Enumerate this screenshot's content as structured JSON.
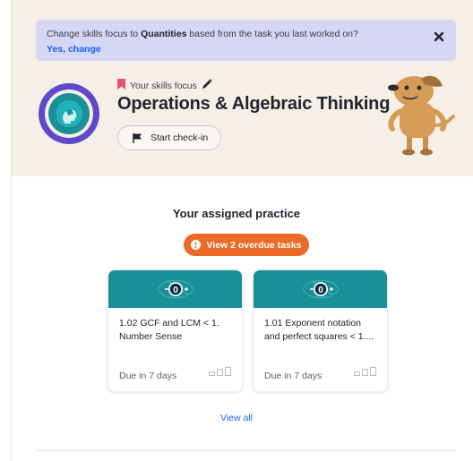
{
  "banner": {
    "text_before": "Change skills focus to ",
    "text_bold": "Quantities",
    "text_after": " based from the task you last worked on?",
    "link": "Yes, change"
  },
  "focus": {
    "label": "Your skills focus",
    "title": "Operations & Algebraic Thinking",
    "checkin_label": "Start check-in"
  },
  "practice": {
    "title": "Your assigned practice",
    "overdue_label": "View 2 overdue tasks",
    "cards": [
      {
        "title": "1.02 GCF and LCM < 1. Number Sense",
        "due": "Due in 7 days",
        "badge": "0"
      },
      {
        "title": "1.01 Exponent notation and perfect squares < 1....",
        "due": "Due in 7 days",
        "badge": "0"
      }
    ],
    "view_all": "View all"
  },
  "colors": {
    "hero_bg": "#f6efe8",
    "banner_bg": "#d6d6f5",
    "ring_purple": "#5d49c9",
    "ring_teal": "#1a8f97",
    "overdue": "#ea6a28",
    "card_header": "#1a8f97",
    "link": "#1865f2"
  },
  "icons": [
    "close-icon",
    "bookmark-icon",
    "pencil-icon",
    "flag-icon",
    "alert-icon",
    "mastery-icon"
  ]
}
